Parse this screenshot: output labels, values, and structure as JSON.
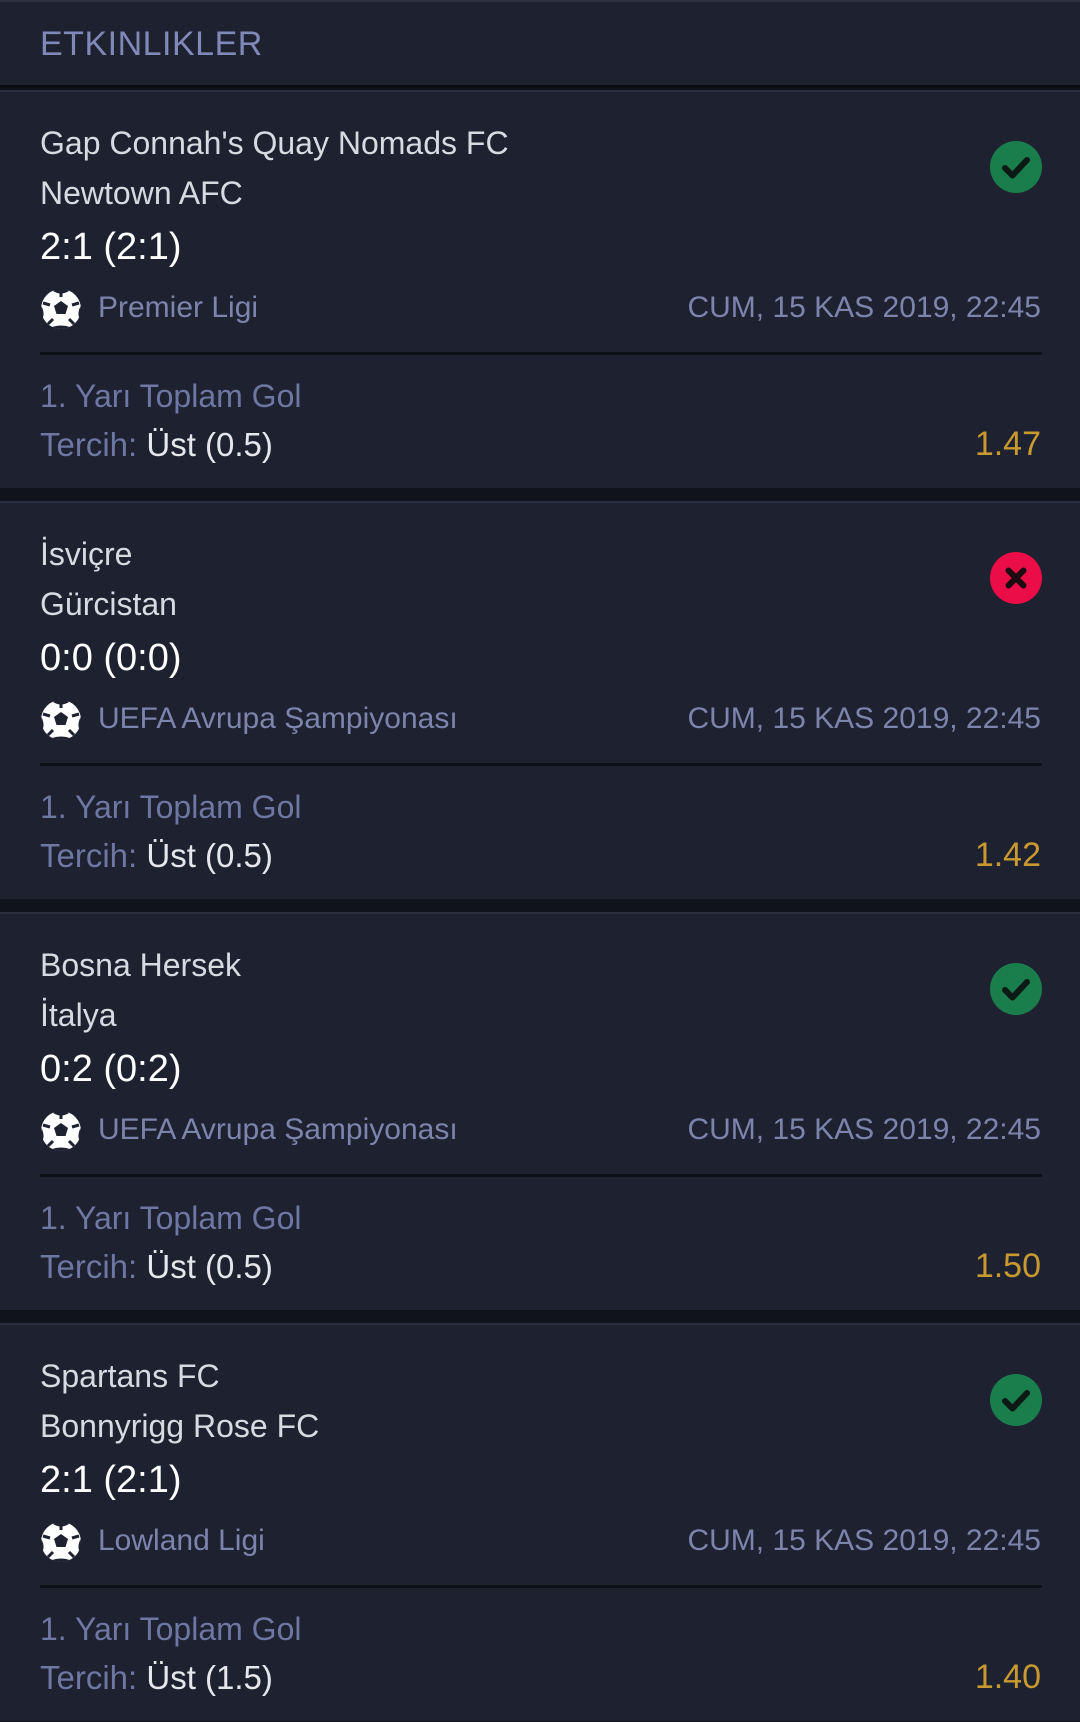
{
  "header": {
    "title": "ETKINLIKLER"
  },
  "events": [
    {
      "team1": "Gap Connah's Quay Nomads FC",
      "team2": "Newtown AFC",
      "score": "2:1 (2:1)",
      "league": "Premier Ligi",
      "datetime": "CUM, 15 KAS 2019, 22:45",
      "market": "1. Yarı Toplam Gol",
      "pref_label": "Tercih:",
      "pref_value": "Üst (0.5)",
      "odds": "1.47",
      "status": "won",
      "status_icon": "check-circle-icon"
    },
    {
      "team1": "İsviçre",
      "team2": "Gürcistan",
      "score": "0:0 (0:0)",
      "league": "UEFA Avrupa Şampiyonası",
      "datetime": "CUM, 15 KAS 2019, 22:45",
      "market": "1. Yarı Toplam Gol",
      "pref_label": "Tercih:",
      "pref_value": "Üst (0.5)",
      "odds": "1.42",
      "status": "lost",
      "status_icon": "x-circle-icon"
    },
    {
      "team1": "Bosna Hersek",
      "team2": "İtalya",
      "score": "0:2 (0:2)",
      "league": "UEFA Avrupa Şampiyonası",
      "datetime": "CUM, 15 KAS 2019, 22:45",
      "market": "1. Yarı Toplam Gol",
      "pref_label": "Tercih:",
      "pref_value": "Üst (0.5)",
      "odds": "1.50",
      "status": "won",
      "status_icon": "check-circle-icon"
    },
    {
      "team1": "Spartans FC",
      "team2": "Bonnyrigg Rose FC",
      "score": "2:1 (2:1)",
      "league": "Lowland Ligi",
      "datetime": "CUM, 15 KAS 2019, 22:45",
      "market": "1. Yarı Toplam Gol",
      "pref_label": "Tercih:",
      "pref_value": "Üst (1.5)",
      "odds": "1.40",
      "status": "won",
      "status_icon": "check-circle-icon"
    }
  ],
  "colors": {
    "background": "#10131b",
    "card": "#1d2130",
    "header_text": "#8189b9",
    "muted_text": "#7d84ac",
    "odds": "#c8992f",
    "win": "#1a7d4c",
    "loss": "#ea0d47"
  }
}
